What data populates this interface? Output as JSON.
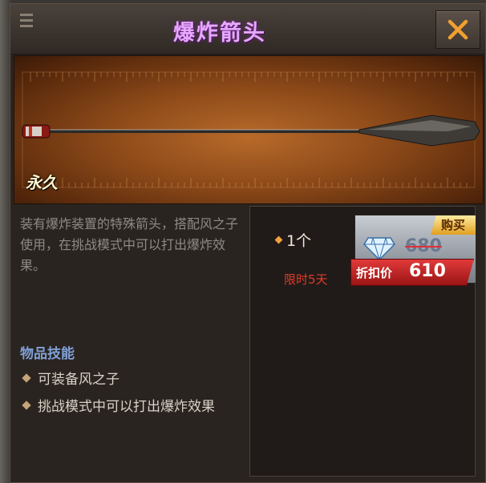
{
  "window": {
    "title": "爆炸箭头"
  },
  "banner": {
    "permanent_badge": "永久"
  },
  "description": "装有爆炸装置的特殊箭头，搭配风之子使用，在挑战模式中可以打出爆炸效果。",
  "skills": {
    "title": "物品技能",
    "items": [
      "可装备风之子",
      "挑战模式中可以打出爆炸效果"
    ]
  },
  "purchase": {
    "quantity": "1个",
    "time_limit": "限时5天",
    "buy_label": "购买",
    "original_price": "680",
    "discount_label": "折扣价",
    "discount_price": "610",
    "currency_icon": "diamond-icon"
  },
  "colors": {
    "title": "#e7a8ff",
    "limit": "#e23a2a",
    "skills_title": "#7fa0d6",
    "close_icon": "#f0a030"
  }
}
